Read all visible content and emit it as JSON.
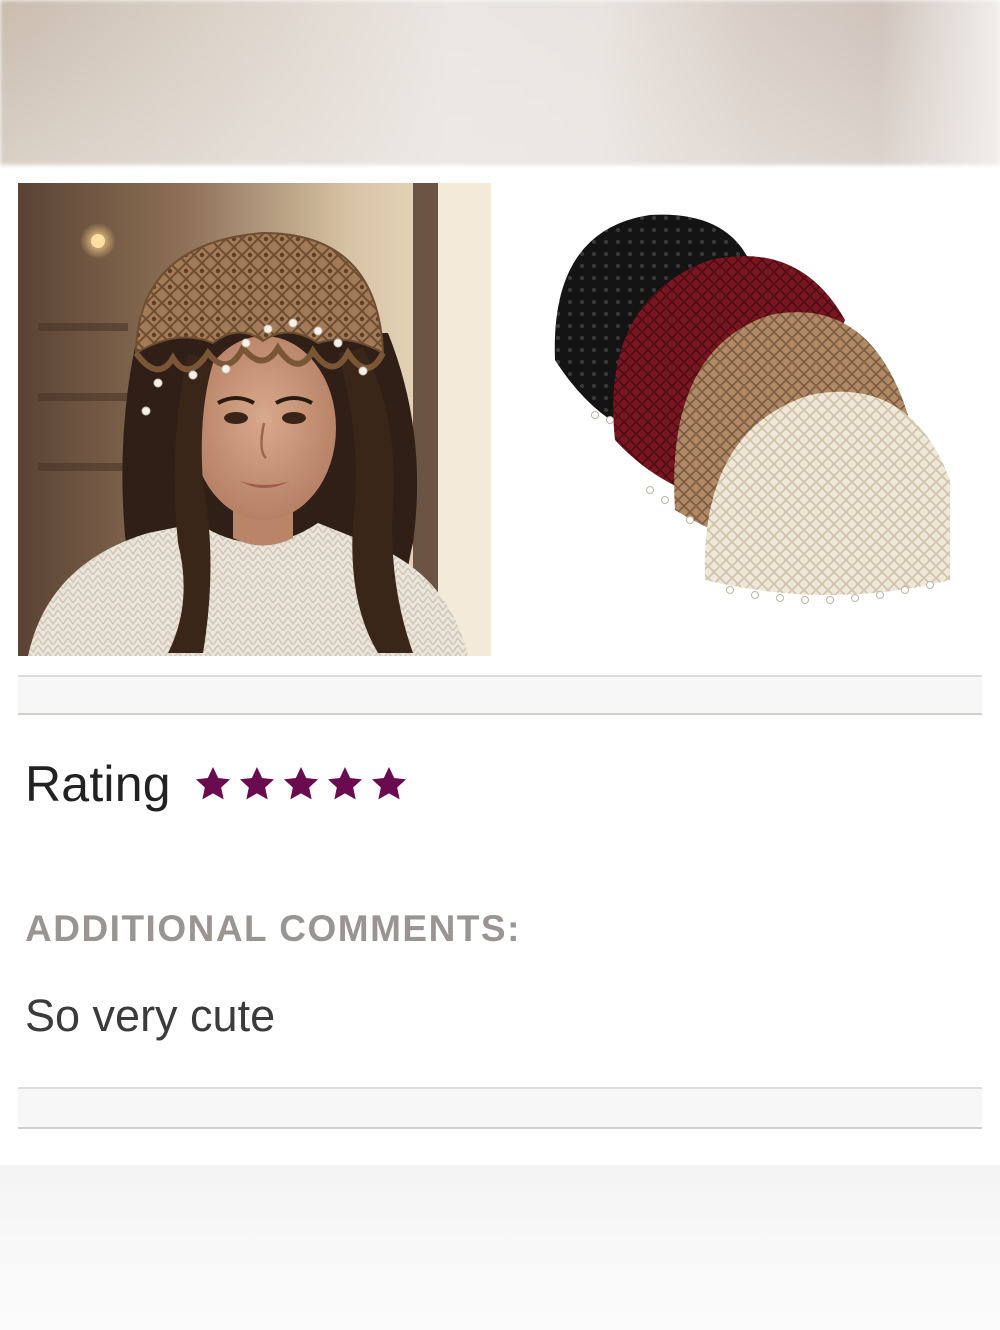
{
  "review": {
    "rating_label": "Rating",
    "rating_value": 5,
    "rating_max": 5,
    "comments_label": "ADDITIONAL COMMENTS:",
    "comment_text": "So very cute"
  },
  "colors": {
    "star": "#6a0a4f",
    "text_dark": "#222222",
    "label_gray": "#9a9592"
  },
  "images": {
    "model_photo": "woman-wearing-brown-crochet-beaded-hat",
    "variants_photo": "four-crochet-hats-black-red-tan-cream"
  }
}
